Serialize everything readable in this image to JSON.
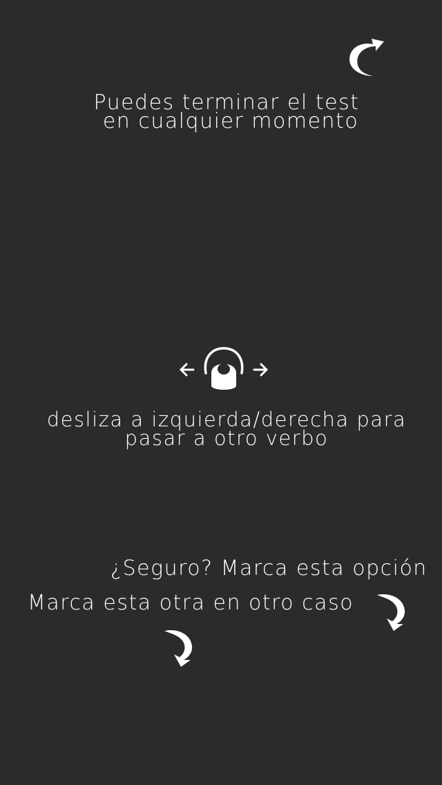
{
  "theme": {
    "background": "#2b2b2b",
    "foreground": "#ffffff"
  },
  "tips": {
    "end_test": {
      "line1": "Puedes terminar el test",
      "line2": "en cualquier momento",
      "icon": "curved-arrow-up-right-icon"
    },
    "swipe": {
      "line1": "desliza a izquierda/derecha para",
      "line2": "pasar a otro verbo",
      "icon": "swipe-left-right-gesture-icon"
    },
    "sure_option": {
      "text": "¿Seguro? Marca esta opción",
      "icon": "curved-arrow-down-icon"
    },
    "other_option": {
      "text": "Marca esta otra en otro caso",
      "icon": "curved-arrow-down-icon"
    }
  }
}
